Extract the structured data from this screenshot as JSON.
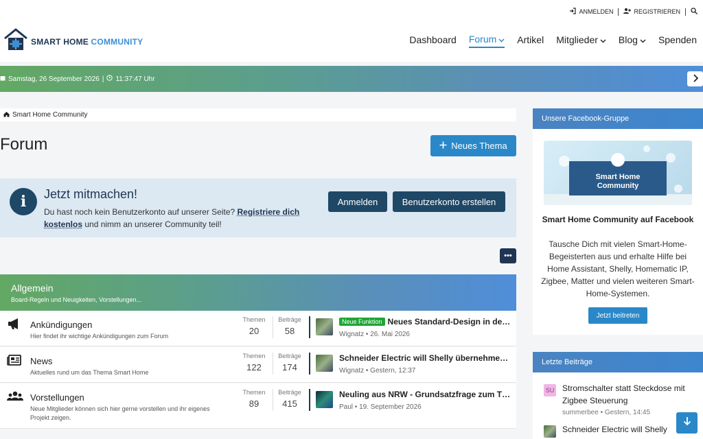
{
  "top_links": {
    "login": "ANMELDEN",
    "register": "REGISTRIEREN"
  },
  "logo": {
    "part1": "SMART HOME",
    "part2": "COMMUNITY"
  },
  "nav": [
    "Dashboard",
    "Forum",
    "Artikel",
    "Mitglieder",
    "Blog",
    "Spenden"
  ],
  "banner": {
    "date": "Samstag, 26 September 2026",
    "time": "11:37:47 Uhr"
  },
  "breadcrumb": "Smart Home Community",
  "page_title": "Forum",
  "new_topic_label": "Neues Thema",
  "join": {
    "title": "Jetzt mitmachen!",
    "desc_1": "Du hast noch kein Benutzerkonto auf unserer Seite? ",
    "desc_link": "Registriere dich kostenlos",
    "desc_2": " und nimm an unserer Community teil!",
    "login_btn": "Anmelden",
    "register_btn": "Benutzerkonto erstellen"
  },
  "more_label": "•••",
  "category": {
    "title": "Allgemein",
    "desc": "Board-Regeln und Neuigkeiten, Vorstellungen..."
  },
  "stat_labels": {
    "topics": "Themen",
    "posts": "Beiträge"
  },
  "boards": [
    {
      "name": "Ankündigungen",
      "desc": "Hier findet ihr wichtige Ankündigungen zum Forum",
      "topics": "20",
      "posts": "58",
      "badge": "Neue Funktion",
      "last_title": "Neues Standard-Design in der Smart Home Community",
      "last_meta": "Wignatz • 26. Mai 2026"
    },
    {
      "name": "News",
      "desc": "Aktuelles rund um das Thema Smart Home",
      "topics": "122",
      "posts": "174",
      "last_title": "Schneider Electric will Shelly übernehmen – Milliardendeal",
      "last_meta": "Wignatz • Gestern, 12:37"
    },
    {
      "name": "Vorstellungen",
      "desc": "Neue Mitglieder können sich hier gerne vorstellen und ihr eigenes Projekt zeigen.",
      "topics": "89",
      "posts": "415",
      "last_title": "Neuling aus NRW - Grundsatzfrage zum Thema",
      "last_meta": "Paul • 19. September 2026"
    }
  ],
  "facebook": {
    "header": "Unsere Facebook-Gruppe",
    "card_line1": "Smart Home",
    "card_line2": "Community",
    "title": "Smart Home Community auf Facebook",
    "desc": "Tausche Dich mit vielen Smart-Home-Begeisterten aus und erhalte Hilfe bei Home Assistant, Shelly, Homematic IP, Zigbee, Matter und vielen weiteren Smart-Home-Systemen.",
    "button": "Jetzt beitreten"
  },
  "recent": {
    "header": "Letzte Beiträge",
    "items": [
      {
        "avatar": "SU",
        "title": "Stromschalter statt Steckdose mit Zigbee Steuerung",
        "meta": "summerbee • Gestern, 14:45"
      },
      {
        "title": "Schneider Electric will Shelly"
      }
    ]
  },
  "icons": {
    "login": "sign-in-icon",
    "register": "user-plus-icon",
    "search": "search-icon",
    "calendar": "calendar-icon",
    "clock": "clock-icon",
    "home": "home-icon",
    "plus": "plus-icon",
    "info": "info-icon",
    "megaphone": "megaphone-icon",
    "newspaper": "newspaper-icon",
    "users": "users-icon",
    "arrow_down": "arrow-down-icon"
  },
  "colors": {
    "accent": "#2a88c8",
    "dark": "#1f3553",
    "green_badge": "#1ea635"
  }
}
